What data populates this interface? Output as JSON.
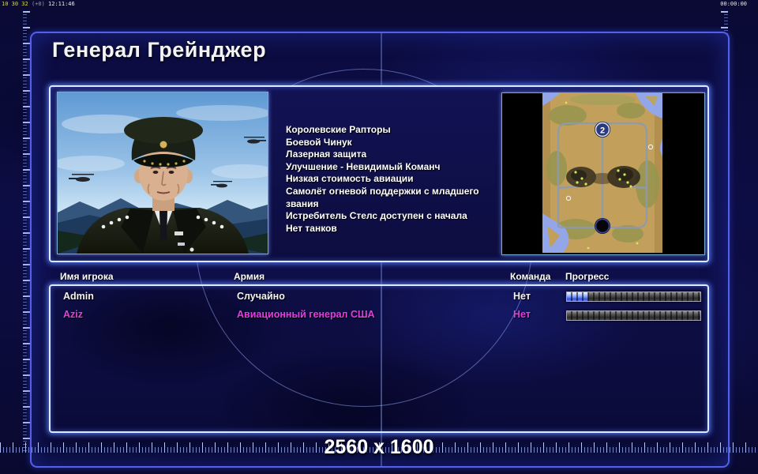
{
  "status_bar": {
    "fps_counter": "10 30 32",
    "delta": "(+0)",
    "session_time": "12:11:46",
    "match_time": "00:00:00"
  },
  "screen": {
    "title": "Генерал Грейнджер",
    "resolution_label": "2560 x 1600"
  },
  "general_info": {
    "features": [
      "Королевские Рапторы",
      "Боевой Чинук",
      "Лазерная защита",
      "Улучшение - Невидимый Команч",
      "Низкая стоимость авиации",
      "Самолёт огневой поддержки с младшего звания",
      "Истребитель Стелс доступен с начала",
      "Нет танков"
    ]
  },
  "map_preview": {
    "start_marker_label": "2"
  },
  "player_table": {
    "columns": [
      "Имя игрока",
      "Армия",
      "Команда",
      "Прогресс"
    ],
    "rows": [
      {
        "name": "Admin",
        "army": "Случайно",
        "team": "Нет",
        "progress_pct": 16,
        "color": "#f2f2f2"
      },
      {
        "name": "Aziz",
        "army": "Авиационный генерал США",
        "team": "Нет",
        "progress_pct": 0,
        "color": "#e23ee2"
      }
    ]
  },
  "colors": {
    "accent_glow": "#dce9ff",
    "frame_border": "#5560e8",
    "magenta_player": "#e23ee2",
    "map_sand": "#c2a05c",
    "map_water": "#93a6e8",
    "progress_fill": "#3050e0"
  }
}
